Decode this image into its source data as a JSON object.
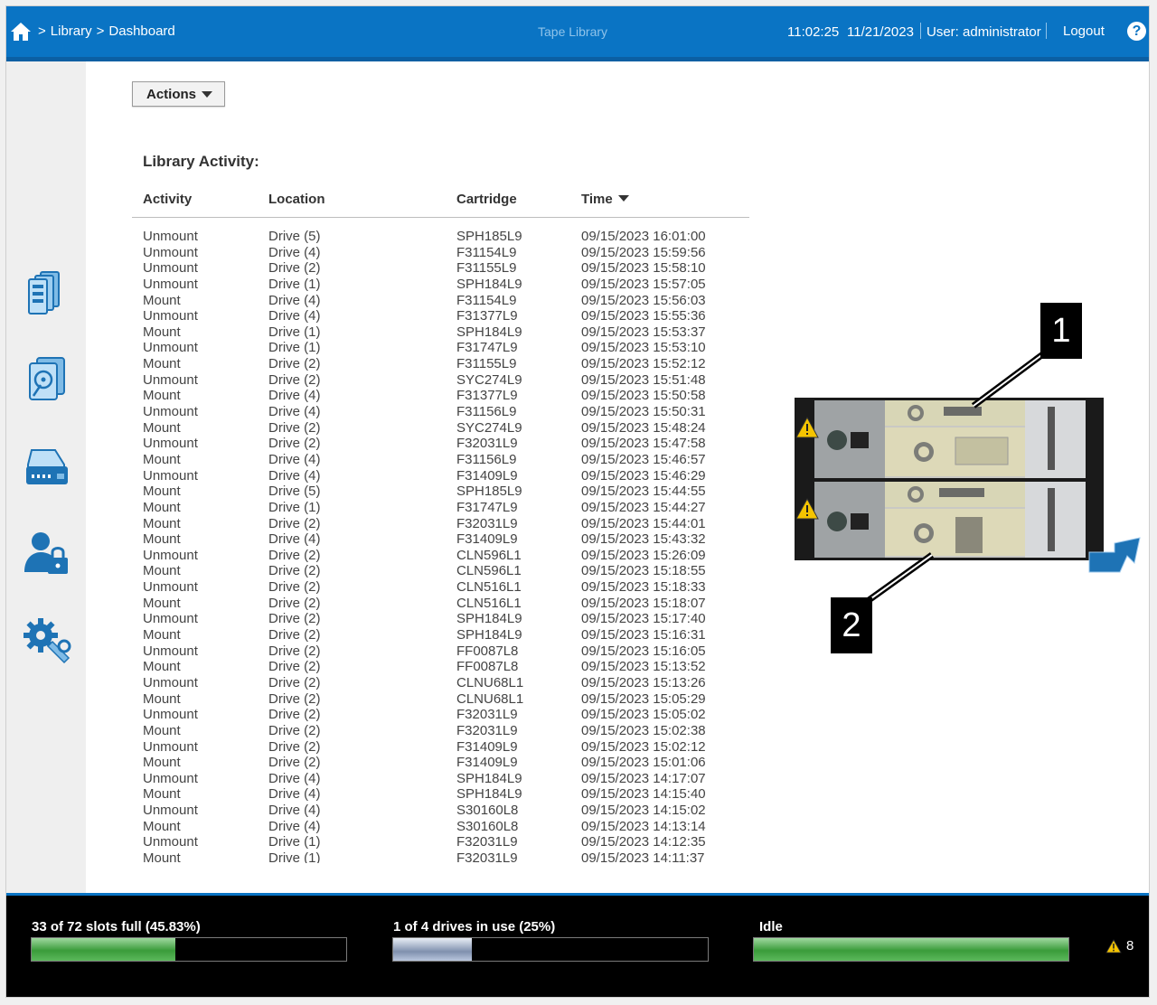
{
  "header": {
    "breadcrumb": [
      ">",
      "Library",
      ">",
      "Dashboard"
    ],
    "app_title": "Tape Library",
    "time": "11:02:25",
    "date": "11/21/2023",
    "user": "User: administrator",
    "logout": "Logout",
    "help": "?"
  },
  "sidebar": {
    "icons": [
      "library-icon",
      "drive-icon",
      "storage-icon",
      "user-security-icon",
      "settings-icon"
    ]
  },
  "actions": {
    "label": "Actions"
  },
  "activity": {
    "title": "Library Activity:",
    "columns": [
      "Activity",
      "Location",
      "Cartridge",
      "Time"
    ],
    "rows": [
      [
        "Unmount",
        "Drive (5)",
        "SPH185L9",
        "09/15/2023 16:01:00"
      ],
      [
        "Unmount",
        "Drive (4)",
        "F31154L9",
        "09/15/2023 15:59:56"
      ],
      [
        "Unmount",
        "Drive (2)",
        "F31155L9",
        "09/15/2023 15:58:10"
      ],
      [
        "Unmount",
        "Drive (1)",
        "SPH184L9",
        "09/15/2023 15:57:05"
      ],
      [
        "Mount",
        "Drive (4)",
        "F31154L9",
        "09/15/2023 15:56:03"
      ],
      [
        "Unmount",
        "Drive (4)",
        "F31377L9",
        "09/15/2023 15:55:36"
      ],
      [
        "Mount",
        "Drive (1)",
        "SPH184L9",
        "09/15/2023 15:53:37"
      ],
      [
        "Unmount",
        "Drive (1)",
        "F31747L9",
        "09/15/2023 15:53:10"
      ],
      [
        "Mount",
        "Drive (2)",
        "F31155L9",
        "09/15/2023 15:52:12"
      ],
      [
        "Unmount",
        "Drive (2)",
        "SYC274L9",
        "09/15/2023 15:51:48"
      ],
      [
        "Mount",
        "Drive (4)",
        "F31377L9",
        "09/15/2023 15:50:58"
      ],
      [
        "Unmount",
        "Drive (4)",
        "F31156L9",
        "09/15/2023 15:50:31"
      ],
      [
        "Mount",
        "Drive (2)",
        "SYC274L9",
        "09/15/2023 15:48:24"
      ],
      [
        "Unmount",
        "Drive (2)",
        "F32031L9",
        "09/15/2023 15:47:58"
      ],
      [
        "Mount",
        "Drive (4)",
        "F31156L9",
        "09/15/2023 15:46:57"
      ],
      [
        "Unmount",
        "Drive (4)",
        "F31409L9",
        "09/15/2023 15:46:29"
      ],
      [
        "Mount",
        "Drive (5)",
        "SPH185L9",
        "09/15/2023 15:44:55"
      ],
      [
        "Mount",
        "Drive (1)",
        "F31747L9",
        "09/15/2023 15:44:27"
      ],
      [
        "Mount",
        "Drive (2)",
        "F32031L9",
        "09/15/2023 15:44:01"
      ],
      [
        "Mount",
        "Drive (4)",
        "F31409L9",
        "09/15/2023 15:43:32"
      ],
      [
        "Unmount",
        "Drive (2)",
        "CLN596L1",
        "09/15/2023 15:26:09"
      ],
      [
        "Mount",
        "Drive (2)",
        "CLN596L1",
        "09/15/2023 15:18:55"
      ],
      [
        "Unmount",
        "Drive (2)",
        "CLN516L1",
        "09/15/2023 15:18:33"
      ],
      [
        "Mount",
        "Drive (2)",
        "CLN516L1",
        "09/15/2023 15:18:07"
      ],
      [
        "Unmount",
        "Drive (2)",
        "SPH184L9",
        "09/15/2023 15:17:40"
      ],
      [
        "Mount",
        "Drive (2)",
        "SPH184L9",
        "09/15/2023 15:16:31"
      ],
      [
        "Unmount",
        "Drive (2)",
        "FF0087L8",
        "09/15/2023 15:16:05"
      ],
      [
        "Mount",
        "Drive (2)",
        "FF0087L8",
        "09/15/2023 15:13:52"
      ],
      [
        "Unmount",
        "Drive (2)",
        "CLNU68L1",
        "09/15/2023 15:13:26"
      ],
      [
        "Mount",
        "Drive (2)",
        "CLNU68L1",
        "09/15/2023 15:05:29"
      ],
      [
        "Unmount",
        "Drive (2)",
        "F32031L9",
        "09/15/2023 15:05:02"
      ],
      [
        "Mount",
        "Drive (2)",
        "F32031L9",
        "09/15/2023 15:02:38"
      ],
      [
        "Unmount",
        "Drive (2)",
        "F31409L9",
        "09/15/2023 15:02:12"
      ],
      [
        "Mount",
        "Drive (2)",
        "F31409L9",
        "09/15/2023 15:01:06"
      ],
      [
        "Unmount",
        "Drive (4)",
        "SPH184L9",
        "09/15/2023 14:17:07"
      ],
      [
        "Mount",
        "Drive (4)",
        "SPH184L9",
        "09/15/2023 14:15:40"
      ],
      [
        "Unmount",
        "Drive (4)",
        "S30160L8",
        "09/15/2023 14:15:02"
      ],
      [
        "Mount",
        "Drive (4)",
        "S30160L8",
        "09/15/2023 14:13:14"
      ],
      [
        "Unmount",
        "Drive (1)",
        "F32031L9",
        "09/15/2023 14:12:35"
      ],
      [
        "Mount",
        "Drive (1)",
        "F32031L9",
        "09/15/2023 14:11:37"
      ]
    ]
  },
  "library_view": {
    "callouts": [
      "1",
      "2"
    ],
    "warning_icons": 2
  },
  "status": {
    "slots": {
      "label": "33 of 72 slots full (45.83%)",
      "fraction": 0.4583
    },
    "drives": {
      "label": "1 of 4 drives in use (25%)",
      "fraction": 0.25
    },
    "state": {
      "label": "Idle",
      "fraction": 1.0
    },
    "warnings": "8"
  },
  "colors": {
    "header_blue": "#0a74c4",
    "status_green": "#3a9c3a",
    "warning_yellow": "#f5c400"
  }
}
